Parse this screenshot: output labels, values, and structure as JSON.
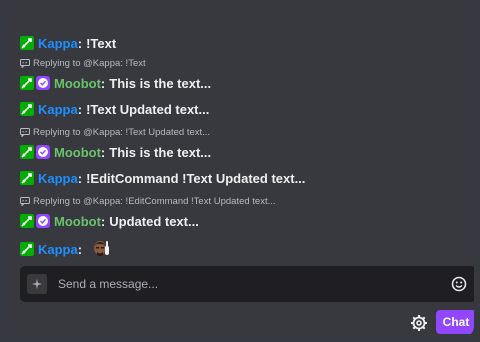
{
  "messages": [
    {
      "type": "chat",
      "badges": [
        "mod-badge"
      ],
      "user": "Kappa",
      "text": "!Text"
    },
    {
      "type": "reply",
      "text": "Replying to @Kappa: !Text"
    },
    {
      "type": "chat",
      "badges": [
        "mod-badge",
        "verified-badge"
      ],
      "user": "Moobot",
      "text": "This is the text..."
    },
    {
      "type": "chat",
      "badges": [
        "mod-badge"
      ],
      "user": "Kappa",
      "text": "!Text Updated text..."
    },
    {
      "type": "reply",
      "text": "Replying to @Kappa: !Text Updated text..."
    },
    {
      "type": "chat",
      "badges": [
        "mod-badge",
        "verified-badge"
      ],
      "user": "Moobot",
      "text": "This is the text..."
    },
    {
      "type": "chat",
      "badges": [
        "mod-badge"
      ],
      "user": "Kappa",
      "text": "!EditCommand !Text Updated text..."
    },
    {
      "type": "reply",
      "text": "Replying to @Kappa: !EditCommand !Text Updated text..."
    },
    {
      "type": "chat",
      "badges": [
        "mod-badge",
        "verified-badge"
      ],
      "user": "Moobot",
      "text": "Updated text..."
    },
    {
      "type": "chat",
      "badges": [
        "mod-badge"
      ],
      "user": "Kappa",
      "text": "",
      "emote": "pointing-emote"
    }
  ],
  "m0": {
    "user": "Kappa",
    "text": "!Text"
  },
  "m1": {
    "text": "Replying to @Kappa: !Text"
  },
  "m2": {
    "user": "Moobot",
    "text": "This is the text..."
  },
  "m3": {
    "user": "Kappa",
    "text": "!Text Updated text..."
  },
  "m4": {
    "text": "Replying to @Kappa: !Text Updated text..."
  },
  "m5": {
    "user": "Moobot",
    "text": "This is the text..."
  },
  "m6": {
    "user": "Kappa",
    "text": "!EditCommand !Text Updated text..."
  },
  "m7": {
    "text": "Replying to @Kappa: !EditCommand !Text Updated text..."
  },
  "m8": {
    "user": "Moobot",
    "text": "Updated text..."
  },
  "m9": {
    "user": "Kappa"
  },
  "colon": ":",
  "input": {
    "placeholder": "Send a message..."
  },
  "chat_button": {
    "label": "Chat"
  },
  "colors": {
    "background": "#36393f",
    "input": "#1f1f23",
    "accent": "#9147ff",
    "mod_badge": "#00ad03",
    "kappa_name": "#1e90ff",
    "moobot_name": "#6ac36a"
  },
  "icons": [
    "sword-icon",
    "checkmark-icon",
    "reply-icon",
    "sparkle-icon",
    "emoji-icon",
    "gear-icon"
  ]
}
